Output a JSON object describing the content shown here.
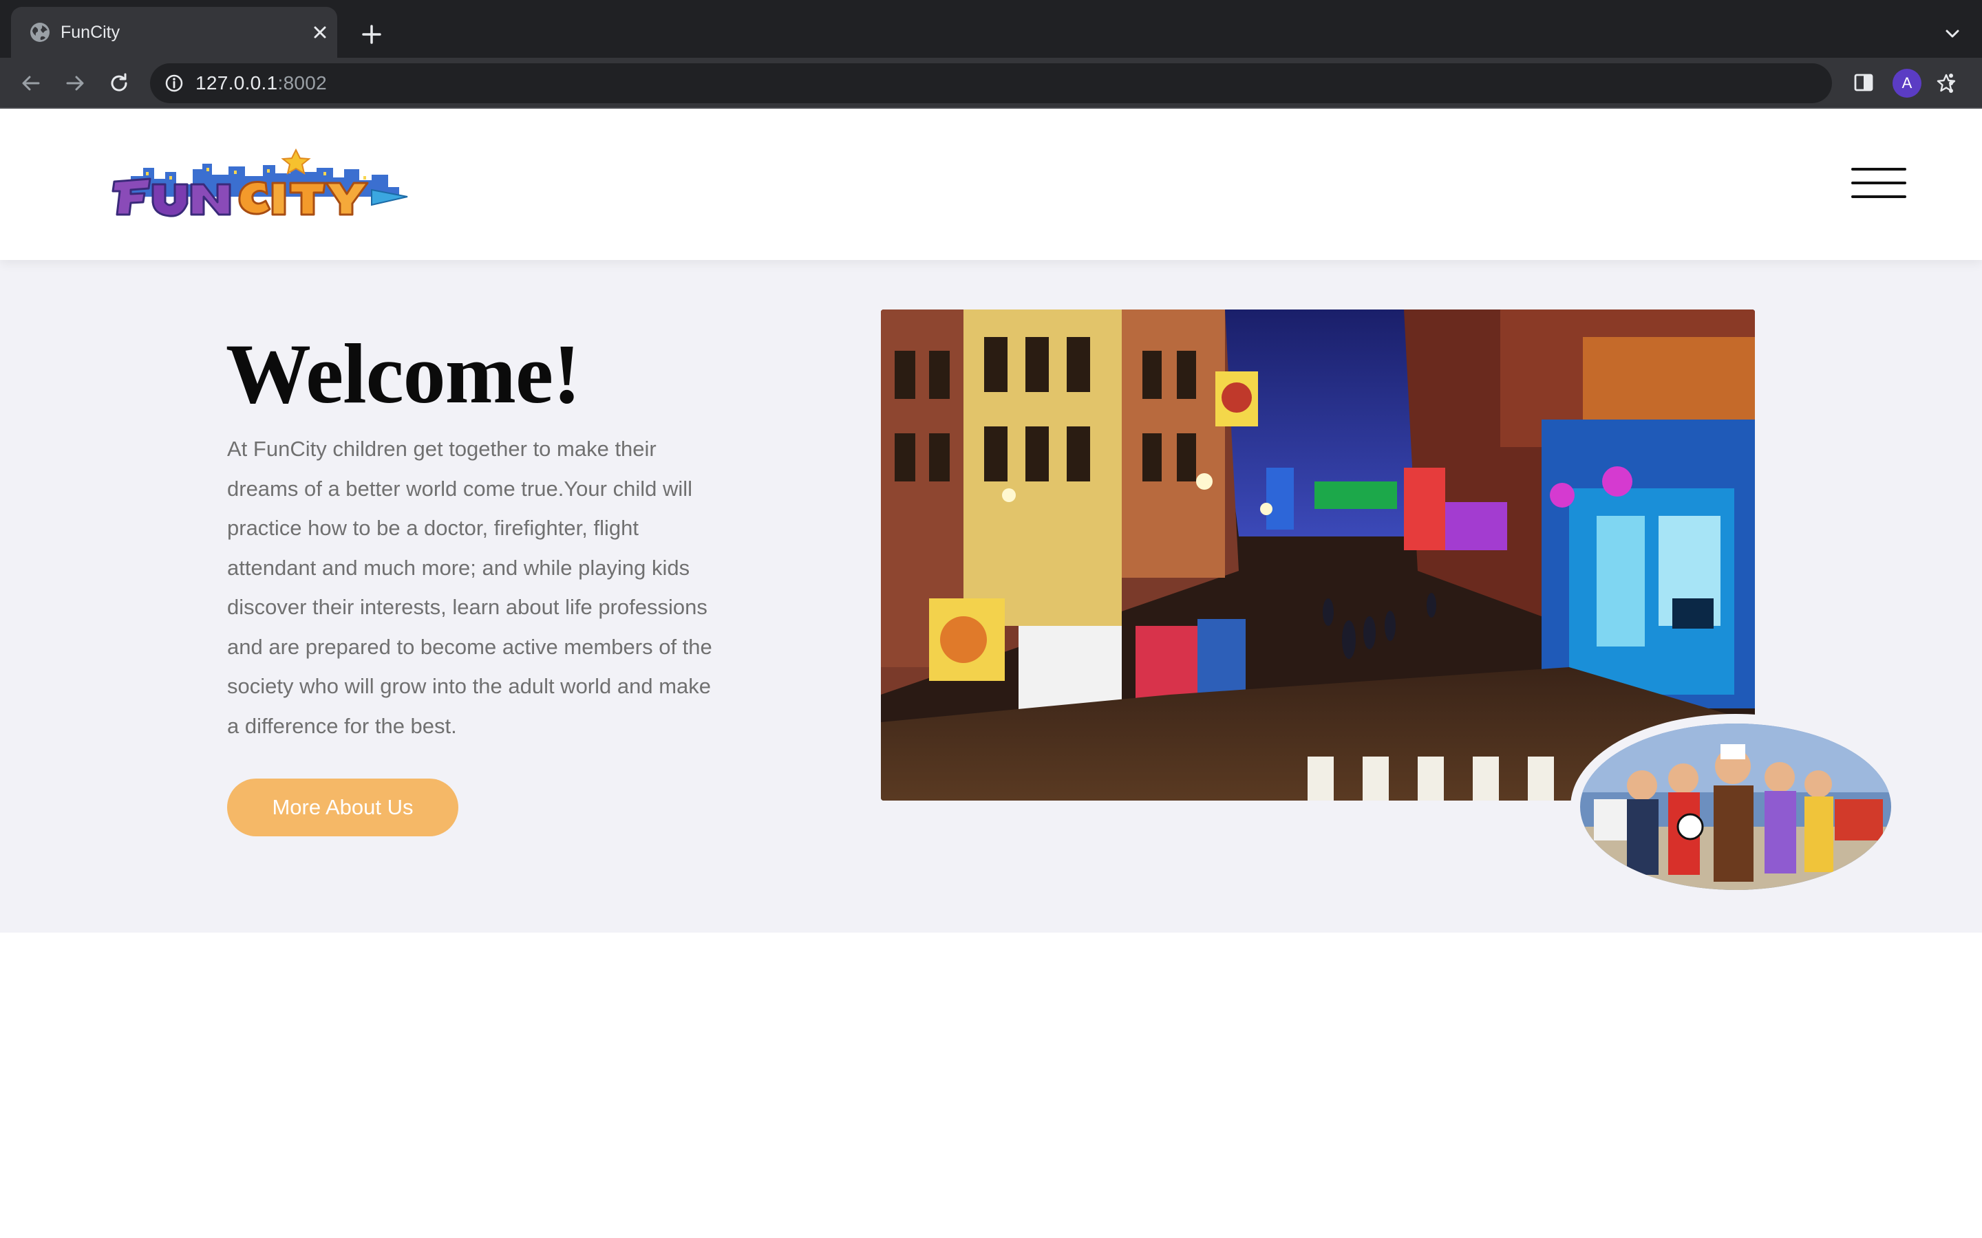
{
  "browser": {
    "tab_title": "FunCity",
    "url_host": "127.0.0.1",
    "url_port": ":8002",
    "profile_initial": "A"
  },
  "site": {
    "logo_text": "FunCity",
    "menu_icon": "hamburger-icon"
  },
  "hero": {
    "title": "Welcome!",
    "body": "At FunCity children get together to make their dreams of a better world come true.Your child will practice how to be a doctor, firefighter, flight attendant and much more; and while playing kids discover their interests, learn about life professions and are prepared to become active members of the society who will grow into the adult world and make a difference for the best.",
    "cta_label": "More About Us"
  },
  "colors": {
    "accent": "#f5b867",
    "hero_bg": "#f2f2f7",
    "title": "#0b0b0b",
    "body_text": "#707070"
  }
}
